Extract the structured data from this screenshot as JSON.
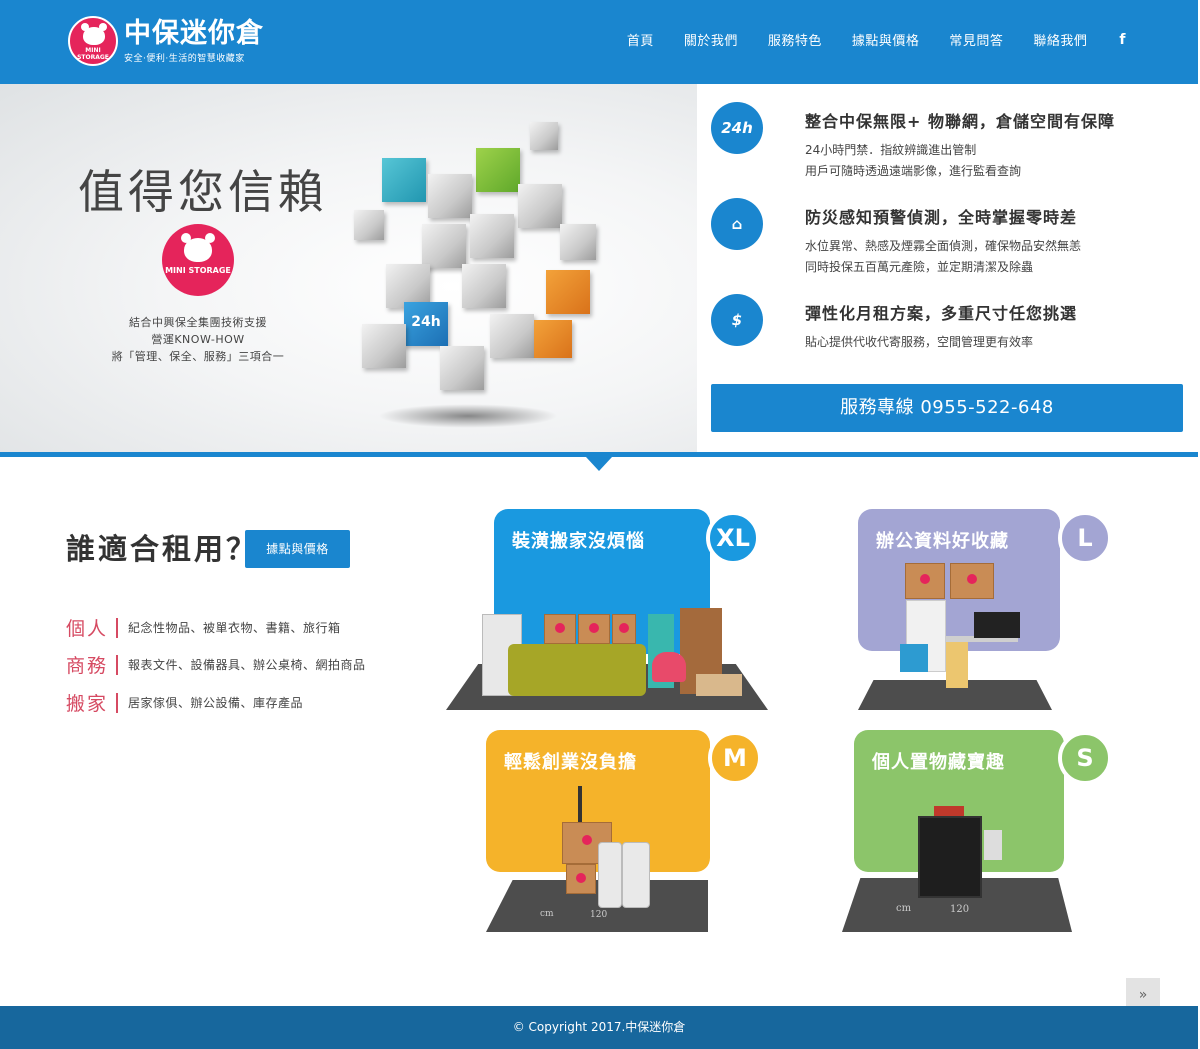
{
  "header": {
    "logo_title": "中保迷你倉",
    "logo_sub": "安全·便利·生活的智慧收藏家",
    "logo_badge_text": "MINI STORAGE",
    "nav": [
      "首頁",
      "關於我們",
      "服務特色",
      "據點與價格",
      "常見問答",
      "聯絡我們"
    ],
    "social_icon": "f"
  },
  "hero": {
    "title": "值得您信賴",
    "badge_text": "MINI STORAGE",
    "desc_lines": [
      "結合中興保全集團技術支援",
      "營運KNOW-HOW",
      "將「管理、保全、服務」三項合一"
    ],
    "cube_icons": [
      "24h"
    ],
    "features": [
      {
        "icon": "24h",
        "icon_name": "24h-icon",
        "title": "整合中保無限+ 物聯網，倉儲空間有保障",
        "lines": [
          "24小時門禁．指紋辨識進出管制",
          "用戶可隨時透過遠端影像，進行監看查詢"
        ]
      },
      {
        "icon": "⌂",
        "icon_name": "home-sensor-icon",
        "title": "防災感知預警偵測，全時掌握零時差",
        "lines": [
          "水位異常、熱感及煙霧全面偵測，確保物品安然無恙",
          "同時投保五百萬元產險，並定期清潔及除蟲"
        ]
      },
      {
        "icon": "$",
        "icon_name": "money-hand-icon",
        "title": "彈性化月租方案，多重尺寸任您挑選",
        "lines": [
          "貼心提供代收代寄服務，空間管理更有效率"
        ]
      }
    ],
    "hotline": "服務專線 0955-522-648"
  },
  "who": {
    "title": "誰適合租用？",
    "button": "據點與價格",
    "rows": [
      {
        "label": "個人",
        "text": "紀念性物品、被單衣物、書籍、旅行箱"
      },
      {
        "label": "商務",
        "text": "報表文件、設備器具、辦公桌椅、網拍商品"
      },
      {
        "label": "搬家",
        "text": "居家傢俱、辦公設備、庫存產品"
      }
    ],
    "cards": [
      {
        "title": "裝潢搬家沒煩惱",
        "size": "XL",
        "color": "#1a86cf"
      },
      {
        "title": "辦公資料好收藏",
        "size": "L",
        "color": "#a3a5d3"
      },
      {
        "title": "輕鬆創業沒負擔",
        "size": "M",
        "color": "#f5b32a"
      },
      {
        "title": "個人置物藏寶趣",
        "size": "S",
        "color": "#8cc56a"
      }
    ],
    "floor_labels": {
      "unit": "cm",
      "width": "120"
    }
  },
  "scroll_top_icon": "»",
  "footer": {
    "copyright": "© Copyright 2017.中保迷你倉"
  }
}
